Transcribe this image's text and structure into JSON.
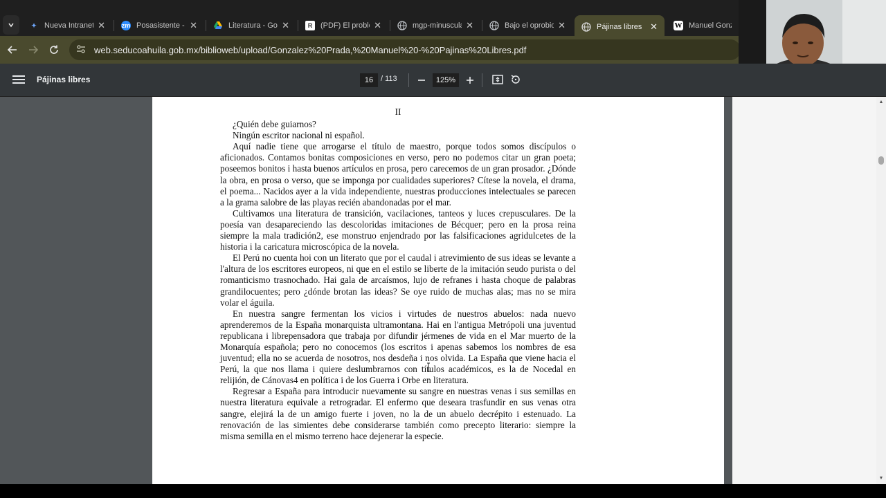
{
  "tabs": [
    {
      "title": "Nueva Intranet c",
      "icon": "intranet-icon",
      "color": "#3b82f6"
    },
    {
      "title": "Posasistente - Zo",
      "icon": "zoom-icon",
      "color": "#2d8cff"
    },
    {
      "title": "Literatura - Goog",
      "icon": "google-drive-icon",
      "color": "#1fa463"
    },
    {
      "title": "(PDF) El problem",
      "icon": "researchgate-icon",
      "color": "#ffffff"
    },
    {
      "title": "mgp-minusculas",
      "icon": "globe-icon",
      "color": "#9aa0a6"
    },
    {
      "title": "Bajo el oprobio",
      "icon": "globe-icon",
      "color": "#9aa0a6"
    },
    {
      "title": "Pájinas libres",
      "icon": "globe-icon",
      "color": "#9aa0a6",
      "active": true
    },
    {
      "title": "Manuel Gonzále",
      "icon": "wikipedia-icon",
      "color": "#ffffff"
    }
  ],
  "address": {
    "url": "web.seducoahuila.gob.mx/biblioweb/upload/Gonzalez%20Prada,%20Manuel%20-%20Pajinas%20Libres.pdf"
  },
  "pdf": {
    "title": "Pájinas libres",
    "page_current": "16",
    "page_total": "/ 113",
    "zoom": "125%"
  },
  "document": {
    "heading": "II",
    "paragraphs": [
      "¿Quién debe guiarnos?",
      "Ningún escritor nacional ni español.",
      "Aquí nadie tiene que arrogarse el título de maestro, porque todos somos discípulos o aficionados. Contamos bonitas composiciones en verso, pero no podemos citar un gran poeta; poseemos bonitos i hasta buenos artículos en prosa, pero carecemos de un gran prosador. ¿Dónde la obra, en prosa o verso, que se imponga por cualidades superiores? Cítese la novela, el drama, el poema... Nacidos ayer a la vida independiente, nuestras producciones intelectuales se parecen a la grama salobre de las playas recién abandonadas por el mar.",
      "Cultivamos una literatura de transición, vacilaciones, tanteos y luces crepusculares. De la poesía van desapareciendo las descoloridas imitaciones de Bécquer; pero en la prosa reina siempre la mala tradición2, ese monstruo enjendrado por las falsificaciones agridulcetes de la historia i la caricatura microscópica de la novela.",
      "El Perú no cuenta hoi con un literato que por el caudal i atrevimiento de sus ideas se levante a l'altura de los escritores europeos, ni que en el estilo se liberte de la imitación seudo purista o del romanticismo trasnochado. Hai gala de arcaísmos, lujo de refranes i hasta choque de palabras grandilocuentes; pero ¿dónde brotan las ideas? Se oye ruido de muchas alas; mas no se mira volar el águila.",
      "En nuestra sangre fermentan los vicios i virtudes de nuestros abuelos: nada nuevo aprenderemos de la España monarquista ultramontana. Hai en l'antigua Metrópoli una juventud republicana i librepensadora que trabaja por difundir jérmenes de vida en el Mar muerto de la Monarquía española; pero no conocemos (los escritos i apenas sabemos los nombres de esa juventud; ella no se acuerda de nosotros, nos desdeña i nos olvida. La España que viene hacia el Perú, la que nos llama i quiere deslumbrarnos con títulos académicos, es la de Nocedal en relijión, de Cánovas4 en política i de los Guerra i Orbe en literatura.",
      "Regresar a España para introducir nuevamente su sangre en nuestras venas i sus semillas en nuestra literatura equivale a retrogradar. El enfermo que deseara trasfundir en sus venas otra sangre, elejirá la de un amigo fuerte i joven, no la de un abuelo decrépito i estenuado. La renovación de las simientes debe considerarse también como precepto literario: siempre la misma semilla en el mismo terreno hace dejenerar la especie."
    ]
  }
}
